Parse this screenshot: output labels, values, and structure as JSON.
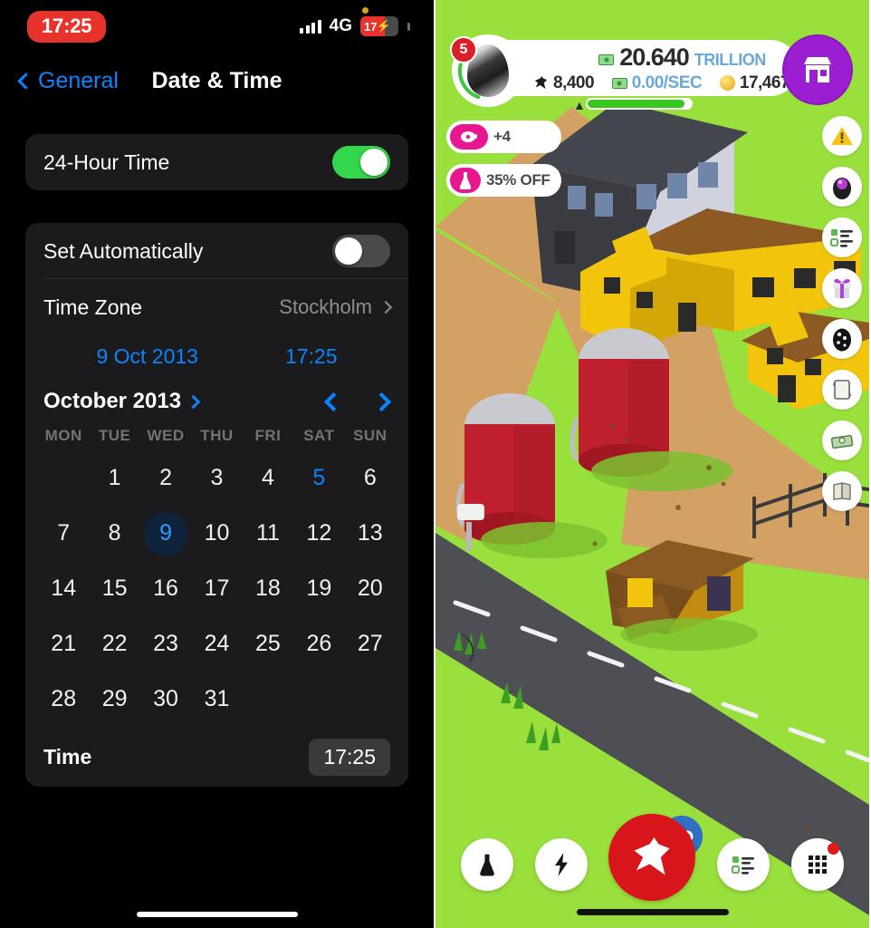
{
  "left_phone": {
    "status_bar": {
      "time": "17:25",
      "network": "4G",
      "battery_level": "17",
      "battery_charging_glyph": "⚡",
      "signal_icon": "signal-bars-icon",
      "recording_dot_icon": "orange-dot-icon"
    },
    "nav": {
      "back_label": "General",
      "back_icon": "chevron-left-icon",
      "title": "Date & Time"
    },
    "group_one": {
      "rows": [
        {
          "label": "24-Hour Time",
          "control": "toggle",
          "state": "on"
        }
      ]
    },
    "group_two": {
      "set_automatically": {
        "label": "Set Automatically",
        "control": "toggle",
        "state": "off"
      },
      "time_zone": {
        "label": "Time Zone",
        "value": "Stockholm",
        "icon": "chevron-right-icon"
      },
      "selected_date": "9 Oct 2013",
      "selected_time": "17:25",
      "calendar": {
        "month_label": "October 2013",
        "month_chevron_icon": "chevron-right-icon",
        "prev_icon": "chevron-left-icon",
        "next_icon": "chevron-right-icon",
        "weekdays": [
          "MON",
          "TUE",
          "WED",
          "THU",
          "FRI",
          "SAT",
          "SUN"
        ],
        "leading_blanks": 1,
        "days": [
          1,
          2,
          3,
          4,
          5,
          6,
          7,
          8,
          9,
          10,
          11,
          12,
          13,
          14,
          15,
          16,
          17,
          18,
          19,
          20,
          21,
          22,
          23,
          24,
          25,
          26,
          27,
          28,
          29,
          30,
          31
        ],
        "today": 9,
        "highlighted_blue": [
          5
        ]
      },
      "time_row": {
        "label": "Time",
        "value": "17:25"
      }
    },
    "home_indicator": "home-indicator"
  },
  "right_phone": {
    "hud": {
      "level": "5",
      "avatar_icon": "egg-avatar-icon",
      "chicken_count": "8,400",
      "chicken_icon": "chicken-icon",
      "cash_amount": "20.640",
      "cash_unit": "TRILLION",
      "cash_icon": "cash-icon",
      "rate": "0.00/SEC",
      "rate_icon": "cash-icon",
      "coins": "17,467",
      "coin_icon": "coin-icon",
      "shop_icon": "shop-icon"
    },
    "promos": [
      {
        "icon": "piggy-bank-icon",
        "label": "+4"
      },
      {
        "icon": "flask-icon",
        "label": "35% OFF"
      }
    ],
    "rail": [
      {
        "icon": "warning-triangle-icon"
      },
      {
        "icon": "purple-egg-icon"
      },
      {
        "icon": "missions-checklist-icon"
      },
      {
        "icon": "gift-icon"
      },
      {
        "icon": "black-egg-icon"
      },
      {
        "icon": "scroll-icon"
      },
      {
        "icon": "cash-stack-icon"
      },
      {
        "icon": "book-icon"
      }
    ],
    "dock": [
      {
        "icon": "flask-icon",
        "variant": "plain"
      },
      {
        "icon": "lightning-bolt-icon",
        "variant": "plain"
      },
      {
        "icon": "chicken-icon",
        "variant": "main"
      },
      {
        "icon": "missions-checklist-icon",
        "variant": "plain"
      },
      {
        "icon": "grid-menu-icon",
        "variant": "plain",
        "badge": true
      }
    ],
    "floating_badge": {
      "icon": "capsule-icon"
    },
    "home_indicator": "home-indicator"
  },
  "colors": {
    "ios_blue": "#0a84ff",
    "toggle_green": "#32d74b",
    "status_red": "#e8332c",
    "grass_green": "#9ae03c",
    "shop_purple": "#9b1fd0",
    "promo_pink": "#e8178f",
    "chicken_red": "#d8151b",
    "road_gray": "#4e4e55",
    "dirt_tan": "#d2a163"
  }
}
